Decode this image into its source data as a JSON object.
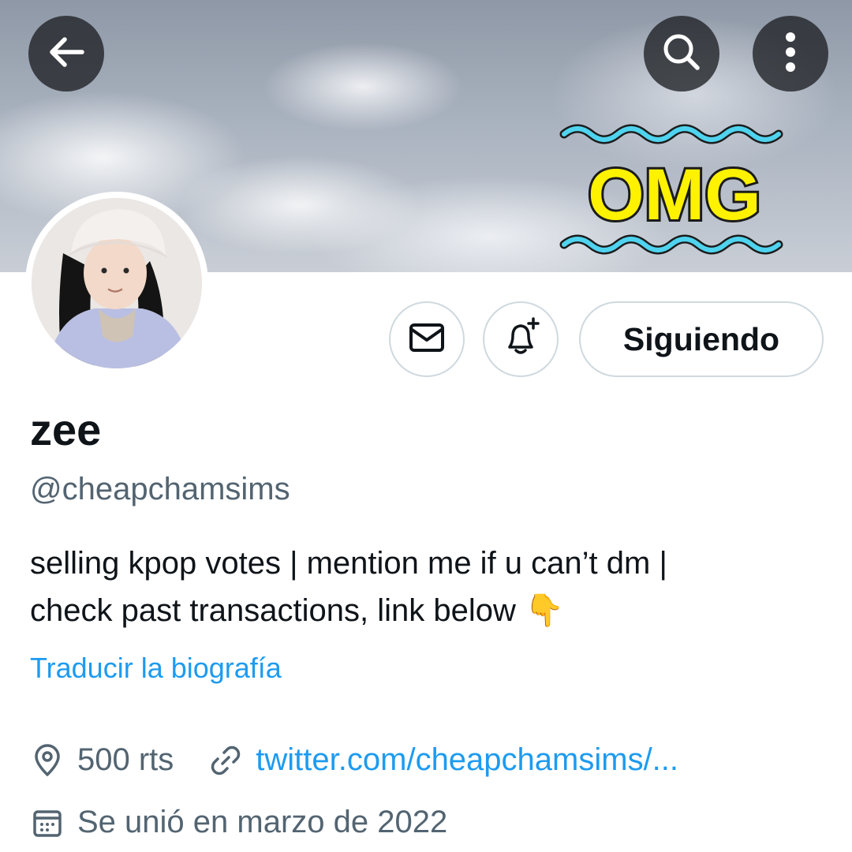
{
  "header": {
    "back_icon": "arrow-left-icon",
    "search_icon": "search-icon",
    "more_icon": "more-vertical-icon",
    "banner_sticker_text": "OMG"
  },
  "actions": {
    "message_icon": "mail-icon",
    "notify_icon": "bell-plus-icon",
    "follow_label": "Siguiendo"
  },
  "profile": {
    "name": "zee",
    "handle": "@cheapchamsims",
    "bio_line1": "selling kpop votes | mention me if u can’t dm |",
    "bio_line2": "check past transactions, link below 👇",
    "translate_label": "Traducir la biografía",
    "location": "500 rts",
    "website": "twitter.com/cheapchamsims/...",
    "joined": "Se unió en marzo de 2022"
  },
  "colors": {
    "accent": "#1d9bf0",
    "text": "#0f1419",
    "muted": "#536471",
    "sticker_yellow": "#fff200",
    "sticker_wave": "#4fd3ee"
  }
}
